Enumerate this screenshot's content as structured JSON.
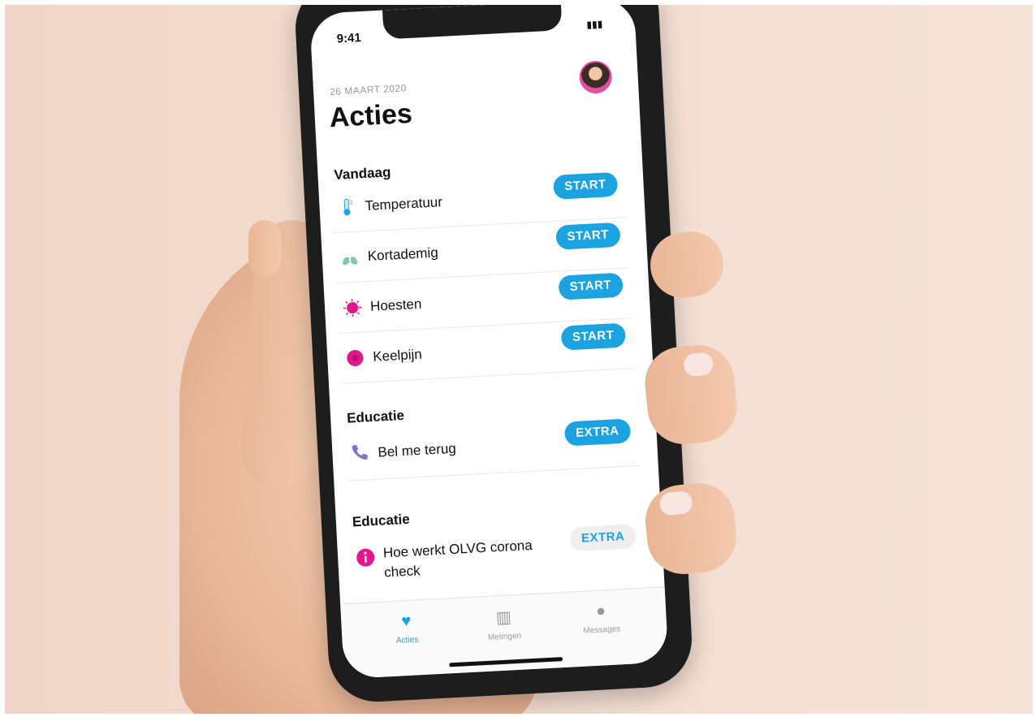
{
  "status_bar": {
    "time": "9:41"
  },
  "header": {
    "date": "26 MAART 2020",
    "title": "Acties"
  },
  "sections": [
    {
      "title": "Vandaag",
      "items": [
        {
          "label": "Temperatuur",
          "action": "START",
          "icon": "thermometer-icon"
        },
        {
          "label": "Kortademig",
          "action": "START",
          "icon": "lungs-icon"
        },
        {
          "label": "Hoesten",
          "action": "START",
          "icon": "virus-icon"
        },
        {
          "label": "Keelpijn",
          "action": "START",
          "icon": "throat-icon"
        }
      ]
    },
    {
      "title": "Educatie",
      "items": [
        {
          "label": "Bel me terug",
          "action": "EXTRA",
          "icon": "phone-icon"
        }
      ]
    },
    {
      "title": "Educatie",
      "items": [
        {
          "label": "Hoe werkt OLVG corona check",
          "action": "EXTRA",
          "icon": "info-icon"
        }
      ]
    }
  ],
  "tabbar": {
    "tabs": [
      {
        "label": "Acties",
        "icon": "heart-icon",
        "active": true
      },
      {
        "label": "Metingen",
        "icon": "bar-chart-icon"
      },
      {
        "label": "Messages",
        "icon": "chat-bubble-icon"
      }
    ]
  },
  "colors": {
    "accent": "#1aa3e0",
    "magenta": "#e3168f",
    "background": "#f3ddd0"
  }
}
